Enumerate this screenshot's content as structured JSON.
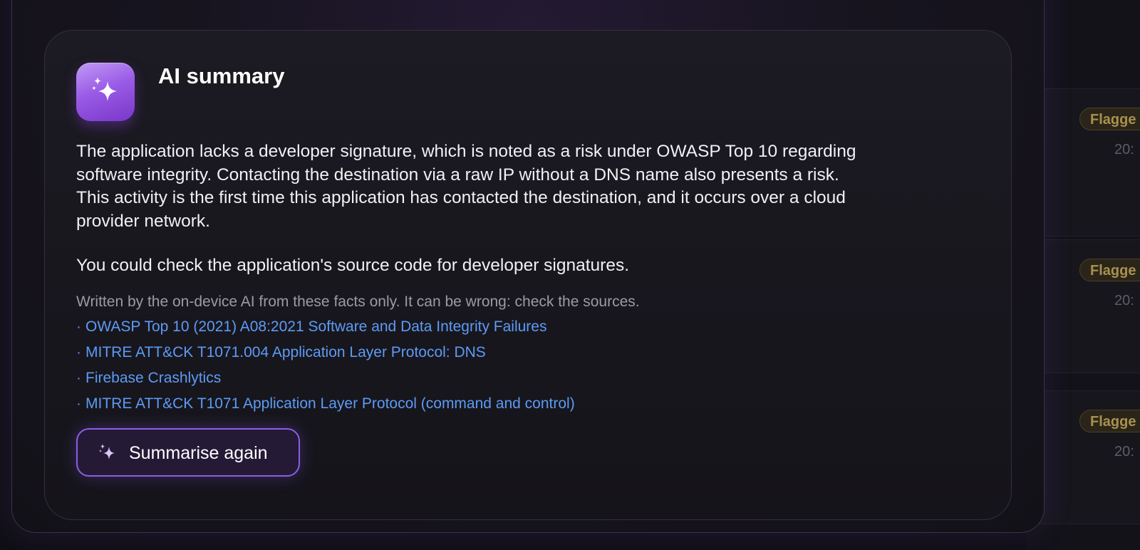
{
  "card": {
    "title": "AI summary",
    "icon": "sparkles-icon",
    "summary_lines": [
      "The application lacks a developer signature, which is noted as a risk under OWASP Top 10 regarding",
      "software integrity. Contacting the destination via a raw IP without a DNS name also presents a risk.",
      "This activity is the first time this application has contacted the destination, and it occurs over a cloud",
      "provider network."
    ],
    "advice": "You could check the application's source code for developer signatures.",
    "disclaimer": "Written by the on-device AI from these facts only. It can be wrong: check the sources.",
    "bullet": "·",
    "sources": [
      "OWASP Top 10 (2021) A08:2021 Software and Data Integrity Failures",
      "MITRE ATT&CK T1071.004 Application Layer Protocol: DNS",
      "Firebase Crashlytics",
      "MITRE ATT&CK T1071 Application Layer Protocol (command and control)"
    ],
    "button_label": "Summarise again"
  },
  "background_list": {
    "badges": [
      "Flagge",
      "Flagge",
      "Flagge"
    ],
    "times": [
      "20:",
      "20:",
      "20:"
    ]
  },
  "colors": {
    "accent_purple": "#9a5ce6",
    "link_blue": "#5d9bf5",
    "flag_amber": "#a8914f"
  }
}
